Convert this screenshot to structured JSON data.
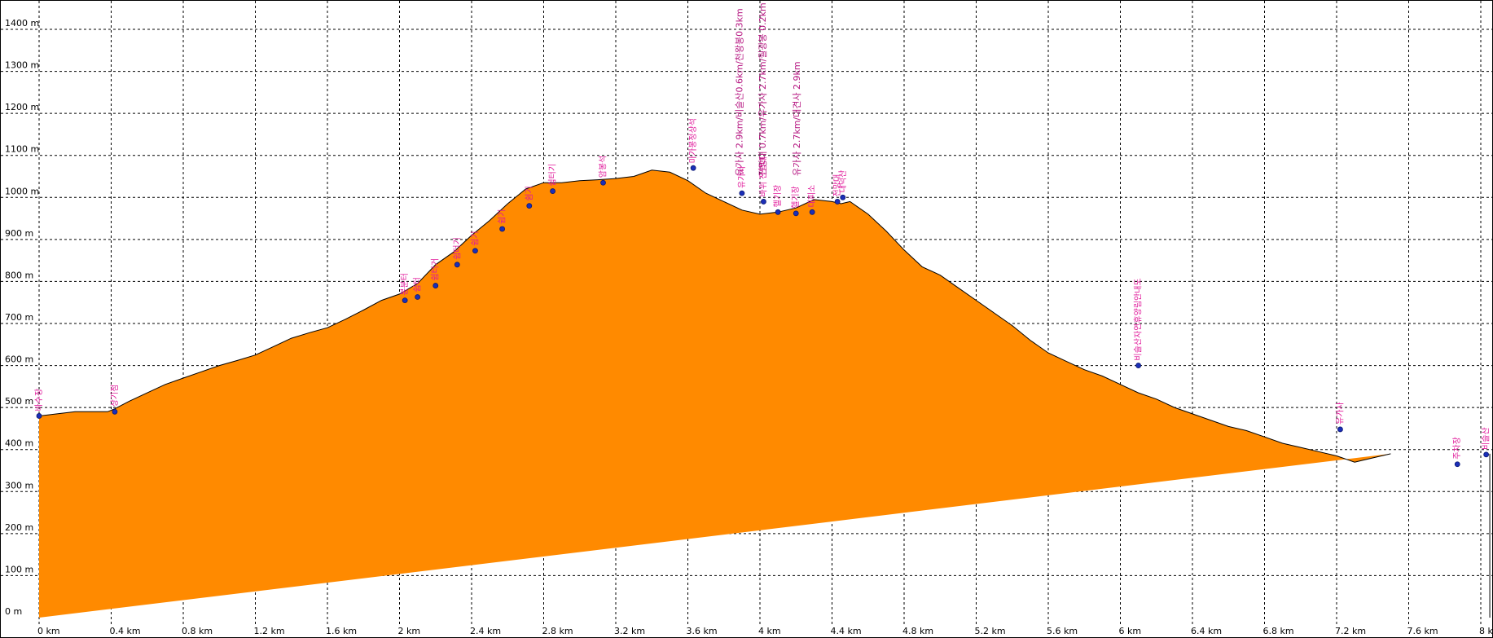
{
  "chart_data": {
    "type": "area",
    "title": "",
    "xlabel": "",
    "ylabel": "",
    "xlim": [
      0,
      8.05
    ],
    "ylim": [
      0,
      1400
    ],
    "grid": true,
    "colors": {
      "fill": "#ff8a00",
      "stroke": "#000000",
      "waypoint": "#1b2fb8",
      "label": "#e0189a",
      "grid": "#000000"
    },
    "x_ticks": [
      {
        "value": 0,
        "label": "0 km"
      },
      {
        "value": 0.4,
        "label": "0.4 km"
      },
      {
        "value": 0.8,
        "label": "0.8 km"
      },
      {
        "value": 1.2,
        "label": "1.2 km"
      },
      {
        "value": 1.6,
        "label": "1.6 km"
      },
      {
        "value": 2.0,
        "label": "2 km"
      },
      {
        "value": 2.4,
        "label": "2.4 km"
      },
      {
        "value": 2.8,
        "label": "2.8 km"
      },
      {
        "value": 3.2,
        "label": "3.2 km"
      },
      {
        "value": 3.6,
        "label": "3.6 km"
      },
      {
        "value": 4.0,
        "label": "4 km"
      },
      {
        "value": 4.4,
        "label": "4.4 km"
      },
      {
        "value": 4.8,
        "label": "4.8 km"
      },
      {
        "value": 5.2,
        "label": "5.2 km"
      },
      {
        "value": 5.6,
        "label": "5.6 km"
      },
      {
        "value": 6.0,
        "label": "6 km"
      },
      {
        "value": 6.4,
        "label": "6.4 km"
      },
      {
        "value": 6.8,
        "label": "6.8 km"
      },
      {
        "value": 7.2,
        "label": "7.2 km"
      },
      {
        "value": 7.6,
        "label": "7.6 km"
      },
      {
        "value": 8.0,
        "label": "8 km"
      }
    ],
    "y_ticks": [
      {
        "value": 0,
        "label": "0 m"
      },
      {
        "value": 100,
        "label": "100 m"
      },
      {
        "value": 200,
        "label": "200 m"
      },
      {
        "value": 300,
        "label": "300 m"
      },
      {
        "value": 400,
        "label": "400 m"
      },
      {
        "value": 500,
        "label": "500 m"
      },
      {
        "value": 600,
        "label": "600 m"
      },
      {
        "value": 700,
        "label": "700 m"
      },
      {
        "value": 800,
        "label": "800 m"
      },
      {
        "value": 900,
        "label": "900 m"
      },
      {
        "value": 1000,
        "label": "1000 m"
      },
      {
        "value": 1100,
        "label": "1100 m"
      },
      {
        "value": 1200,
        "label": "1200 m"
      },
      {
        "value": 1300,
        "label": "1300 m"
      },
      {
        "value": 1400,
        "label": "1400 m"
      }
    ],
    "x": [
      0,
      0.1,
      0.2,
      0.3,
      0.38,
      0.42,
      0.5,
      0.6,
      0.7,
      0.8,
      0.9,
      1.0,
      1.1,
      1.2,
      1.3,
      1.4,
      1.5,
      1.6,
      1.7,
      1.8,
      1.9,
      2.0,
      2.1,
      2.2,
      2.3,
      2.4,
      2.5,
      2.6,
      2.7,
      2.8,
      2.9,
      3.0,
      3.1,
      3.2,
      3.3,
      3.4,
      3.5,
      3.6,
      3.7,
      3.8,
      3.9,
      4.0,
      4.1,
      4.2,
      4.3,
      4.4,
      4.45,
      4.5,
      4.6,
      4.7,
      4.8,
      4.9,
      5.0,
      5.1,
      5.2,
      5.3,
      5.4,
      5.5,
      5.6,
      5.7,
      5.8,
      5.9,
      6.0,
      6.1,
      6.2,
      6.3,
      6.4,
      6.5,
      6.6,
      6.7,
      6.8,
      6.9,
      7.0,
      7.1,
      7.2,
      7.3,
      7.4,
      7.5,
      7.6,
      7.7,
      7.8,
      7.9,
      8.0,
      8.05
    ],
    "values": [
      480,
      485,
      490,
      490,
      490,
      497,
      515,
      535,
      555,
      570,
      585,
      600,
      612,
      625,
      645,
      665,
      678,
      690,
      710,
      732,
      755,
      770,
      795,
      840,
      870,
      910,
      945,
      985,
      1020,
      1035,
      1035,
      1040,
      1042,
      1045,
      1050,
      1065,
      1060,
      1040,
      1010,
      990,
      970,
      960,
      965,
      975,
      995,
      990,
      985,
      990,
      960,
      920,
      875,
      835,
      815,
      785,
      755,
      725,
      695,
      660,
      630,
      610,
      590,
      575,
      555,
      535,
      520,
      500,
      485,
      470,
      455,
      445,
      430,
      415,
      405,
      395,
      385,
      370,
      380,
      390
    ],
    "waypoints": [
      {
        "x": 0.0,
        "y": 480,
        "label": "바수장"
      },
      {
        "x": 0.42,
        "y": 490,
        "label": "상기점"
      },
      {
        "x": 2.03,
        "y": 755,
        "label": "봉분터"
      },
      {
        "x": 2.1,
        "y": 763,
        "label": "쉼터"
      },
      {
        "x": 2.2,
        "y": 790,
        "label": "쉼터거"
      },
      {
        "x": 2.32,
        "y": 840,
        "label": "쉼터기"
      },
      {
        "x": 2.42,
        "y": 873,
        "label": "쉼기"
      },
      {
        "x": 2.57,
        "y": 925,
        "label": "쉼기"
      },
      {
        "x": 2.72,
        "y": 980,
        "label": "쉼기"
      },
      {
        "x": 2.85,
        "y": 1015,
        "label": "쉼터기"
      },
      {
        "x": 3.13,
        "y": 1035,
        "label": "암봉석"
      },
      {
        "x": 3.63,
        "y": 1070,
        "label": "마가봉정상석"
      },
      {
        "x": 3.9,
        "y": 1010,
        "label": "유가사"
      },
      {
        "x": 4.02,
        "y": 990,
        "label": "바위 전망대"
      },
      {
        "x": 4.1,
        "y": 965,
        "label": "헬기장"
      },
      {
        "x": 4.2,
        "y": 962,
        "label": "헬기장"
      },
      {
        "x": 4.29,
        "y": 965,
        "label": "대피소"
      },
      {
        "x": 4.43,
        "y": 990,
        "label": "전망대"
      },
      {
        "x": 4.46,
        "y": 1000,
        "label": "대덕산"
      },
      {
        "x": 6.1,
        "y": 600,
        "label": "비슬산자연휴양림안내도"
      },
      {
        "x": 7.22,
        "y": 448,
        "label": "유가사"
      },
      {
        "x": 7.87,
        "y": 365,
        "label": "주차장"
      },
      {
        "x": 8.03,
        "y": 388,
        "label": "비슬산"
      }
    ],
    "annotations": [
      {
        "x": 3.92,
        "text": "유가사 2.9km/비슬산0.6km/천왕봉0.3km"
      },
      {
        "x": 4.05,
        "text": "전망대 0.7km/유가사 2.7km/월광봉 0.2km"
      },
      {
        "x": 4.24,
        "text": "유가사 2.7km/대견사 2.9km"
      }
    ]
  }
}
